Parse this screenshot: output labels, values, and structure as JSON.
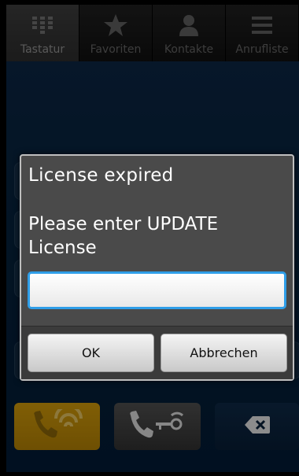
{
  "tabs": [
    {
      "label": "Tastatur",
      "icon": "keypad-icon",
      "active": true
    },
    {
      "label": "Favoriten",
      "icon": "star-icon",
      "active": false
    },
    {
      "label": "Kontakte",
      "icon": "person-icon",
      "active": false
    },
    {
      "label": "Anrufliste",
      "icon": "list-icon",
      "active": false
    }
  ],
  "actions": {
    "call_wifi_icon": "phone-wifi-icon",
    "call_key_icon": "phone-key-icon",
    "backspace_icon": "backspace-icon"
  },
  "dialog": {
    "title": "License expired",
    "message": "Please enter UPDATE License",
    "input_value": "",
    "ok_label": "OK",
    "cancel_label": "Abbrechen"
  },
  "colors": {
    "accent_blue": "#2f9ee8",
    "call_yellow": "#c6920a",
    "dialog_bg": "#4a4a4a"
  }
}
